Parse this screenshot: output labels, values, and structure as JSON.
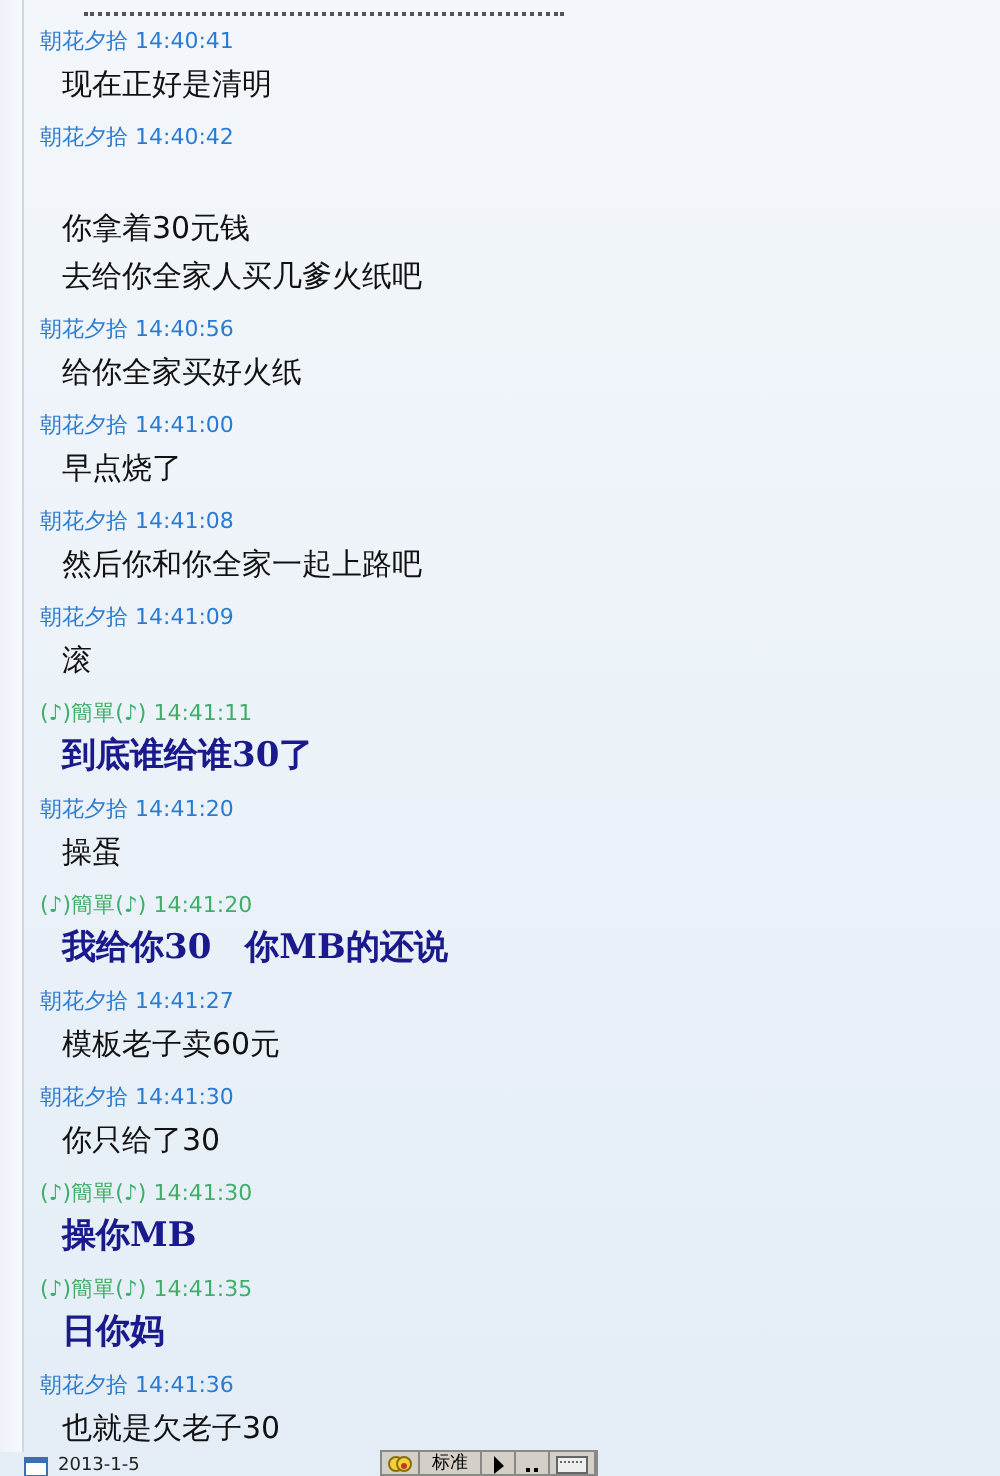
{
  "messages": [
    {
      "kind": "self",
      "header": "朝花夕拾 14:40:41",
      "lines": [
        "现在正好是清明"
      ]
    },
    {
      "kind": "self",
      "header": "朝花夕拾 14:40:42",
      "blank_line_before": true,
      "lines": [
        "你拿着30元钱",
        "去给你全家人买几爹火纸吧"
      ]
    },
    {
      "kind": "self",
      "header": "朝花夕拾 14:40:56",
      "lines": [
        "给你全家买好火纸"
      ]
    },
    {
      "kind": "self",
      "header": "朝花夕拾 14:41:00",
      "lines": [
        "早点烧了"
      ]
    },
    {
      "kind": "self",
      "header": "朝花夕拾 14:41:08",
      "lines": [
        "然后你和你全家一起上路吧"
      ]
    },
    {
      "kind": "self",
      "header": "朝花夕拾 14:41:09",
      "lines": [
        "滚"
      ]
    },
    {
      "kind": "other",
      "header": "(♪)簡單(♪) 14:41:11",
      "lines": [
        "到底谁给谁30了"
      ]
    },
    {
      "kind": "self",
      "header": "朝花夕拾 14:41:20",
      "lines": [
        "操蛋"
      ]
    },
    {
      "kind": "other",
      "header": "(♪)簡單(♪) 14:41:20",
      "lines": [
        "我给你30　你MB的还说"
      ]
    },
    {
      "kind": "self",
      "header": "朝花夕拾 14:41:27",
      "lines": [
        "模板老子卖60元"
      ]
    },
    {
      "kind": "self",
      "header": "朝花夕拾 14:41:30",
      "lines": [
        "你只给了30"
      ]
    },
    {
      "kind": "other",
      "header": "(♪)簡單(♪) 14:41:30",
      "lines": [
        "操你MB"
      ]
    },
    {
      "kind": "other",
      "header": "(♪)簡單(♪) 14:41:35",
      "lines": [
        "日你妈"
      ]
    },
    {
      "kind": "self",
      "header": "朝花夕拾 14:41:36",
      "lines": [
        "也就是欠老子30"
      ]
    }
  ],
  "status_bar": {
    "date": "2013-1-5",
    "mode_button": "标准"
  }
}
